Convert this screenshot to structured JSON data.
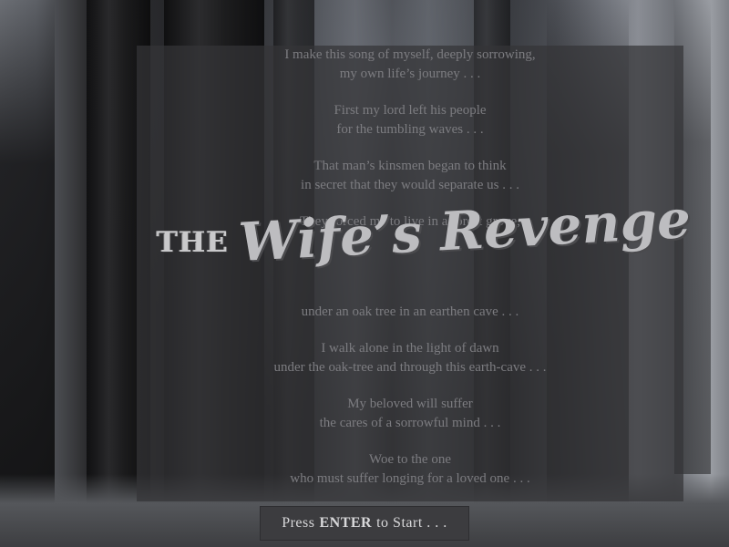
{
  "poem": {
    "stanzas": [
      {
        "lines": [
          "I make this song of myself, deeply sorrowing,",
          "my own life’s journey . . ."
        ]
      },
      {
        "lines": [
          "First my lord left his people",
          "for the tumbling waves . . ."
        ]
      },
      {
        "lines": [
          "That man’s kinsmen began to think",
          "in secret that they would separate us . . ."
        ]
      },
      {
        "lines": [
          "They forced me to live in a forest grove,"
        ]
      },
      {
        "lines": [
          "under an oak tree in an earthen cave . . ."
        ]
      },
      {
        "lines": [
          "I walk alone in the light of dawn",
          "under the oak-tree and through this earth-cave . . ."
        ]
      },
      {
        "lines": [
          "My beloved will suffer",
          "the cares of a sorrowful mind . . ."
        ]
      },
      {
        "lines": [
          "Woe to the one",
          "who must suffer longing for a loved one . . ."
        ]
      }
    ]
  },
  "title": {
    "prefix": "THE",
    "main": "Wife’s Revenge"
  },
  "start": {
    "pre": "Press",
    "key": "ENTER",
    "post": "to Start . . ."
  }
}
